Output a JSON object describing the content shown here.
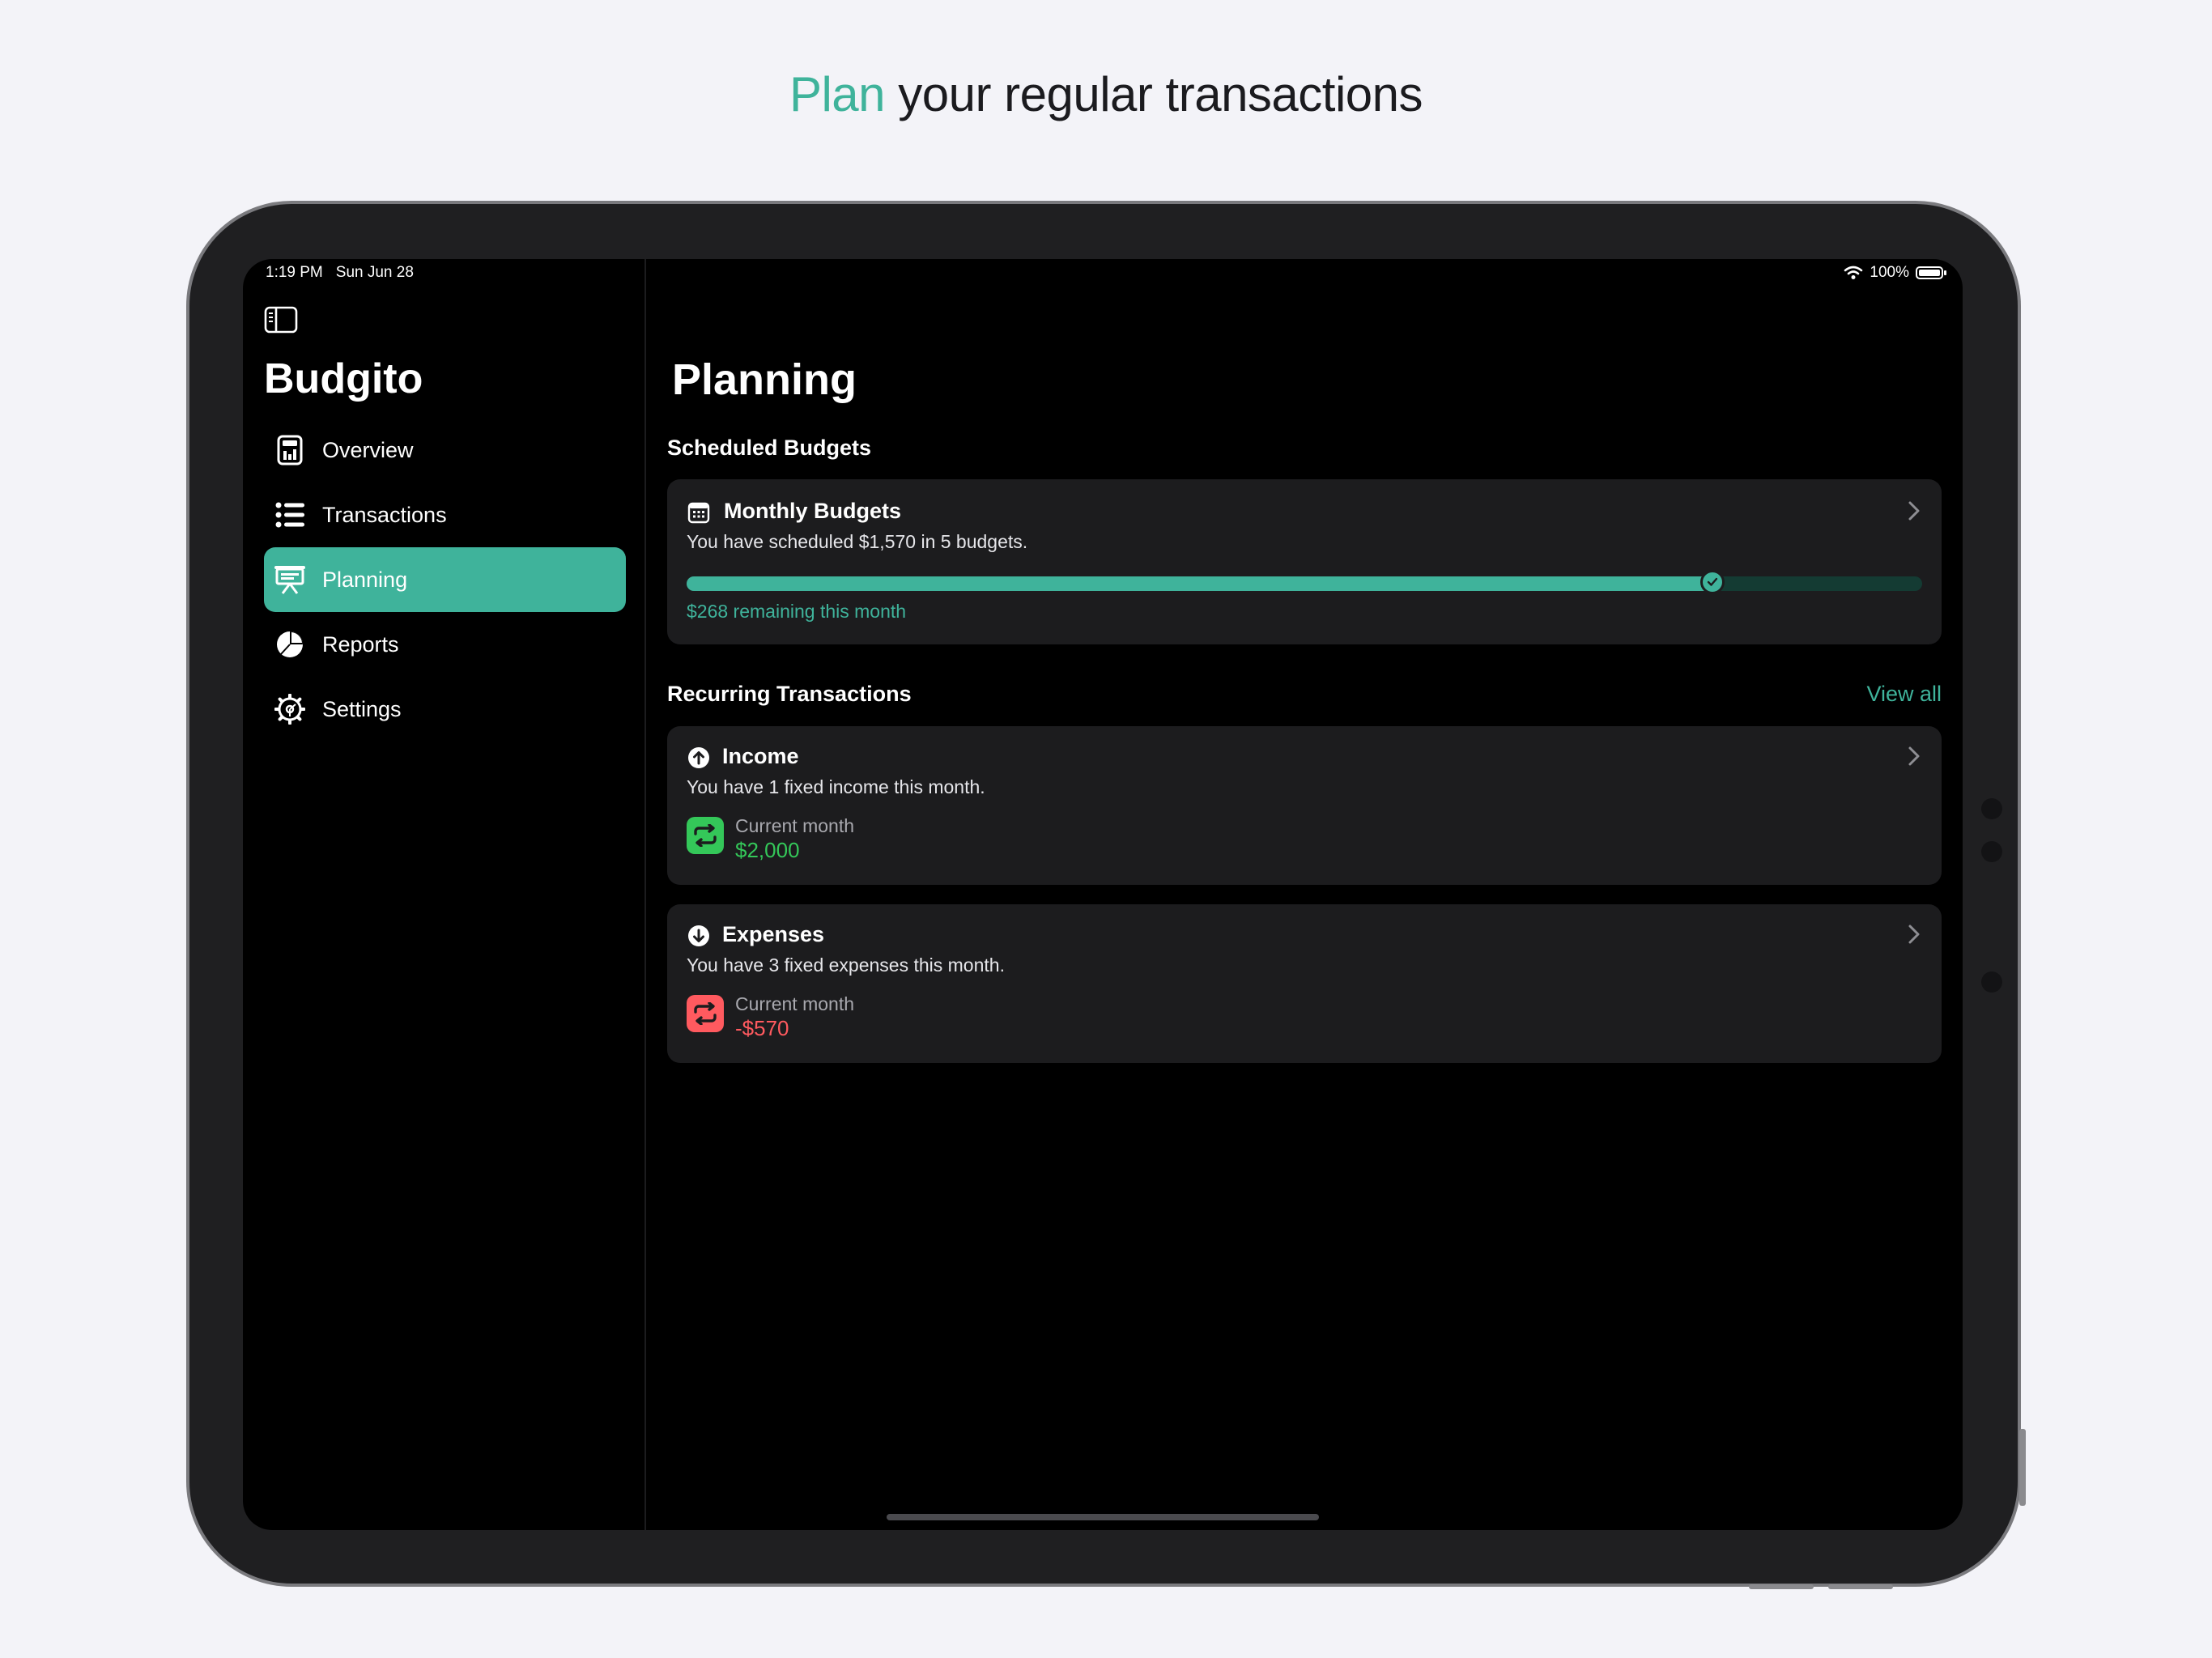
{
  "headline": {
    "accent": "Plan",
    "rest": " your regular transactions"
  },
  "status_bar": {
    "time": "1:19 PM",
    "date": "Sun Jun 28",
    "battery": "100%"
  },
  "app": {
    "title": "Budgito"
  },
  "sidebar": {
    "items": [
      {
        "label": "Overview",
        "icon": "calculator-icon"
      },
      {
        "label": "Transactions",
        "icon": "list-icon"
      },
      {
        "label": "Planning",
        "icon": "presentation-icon",
        "active": true
      },
      {
        "label": "Reports",
        "icon": "pie-chart-icon"
      },
      {
        "label": "Settings",
        "icon": "gear-icon"
      }
    ]
  },
  "main": {
    "title": "Planning",
    "scheduled": {
      "header": "Scheduled Budgets",
      "card": {
        "title": "Monthly Budgets",
        "subtitle": "You have scheduled $1,570 in 5 budgets.",
        "progress": 0.83,
        "remaining": "$268 remaining this month"
      }
    },
    "recurring": {
      "header": "Recurring Transactions",
      "view_all": "View all",
      "income": {
        "title": "Income",
        "subtitle": "You have 1 fixed income this month.",
        "label": "Current month",
        "value": "$2,000"
      },
      "expenses": {
        "title": "Expenses",
        "subtitle": "You have 3 fixed expenses this month.",
        "label": "Current month",
        "value": "-$570"
      }
    }
  },
  "colors": {
    "accent": "#3fb39b",
    "income": "#34c759",
    "expense": "#ff5a5f",
    "card": "#1c1c1e",
    "background": "#000000"
  }
}
